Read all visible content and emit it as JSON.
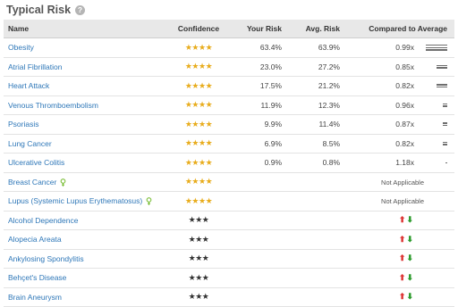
{
  "title": "Typical Risk",
  "help_icon": "?",
  "columns": [
    "Name",
    "Confidence",
    "Your Risk",
    "Avg. Risk",
    "Compared to Average"
  ],
  "rows_full": [
    {
      "name": "Obesity",
      "stars": "★★★★",
      "your": "63.4%",
      "avg": "63.9%",
      "ratio": "0.99x",
      "bar_lines": 3
    },
    {
      "name": "Atrial Fibrillation",
      "stars": "★★★★",
      "your": "23.0%",
      "avg": "27.2%",
      "ratio": "0.85x",
      "bar_lines": 2
    },
    {
      "name": "Heart Attack",
      "stars": "★★★★",
      "your": "17.5%",
      "avg": "21.2%",
      "ratio": "0.82x",
      "bar_lines": 2
    },
    {
      "name": "Venous Thromboembolism",
      "stars": "★★★★",
      "your": "11.9%",
      "avg": "12.3%",
      "ratio": "0.96x",
      "bar_lines": 2
    },
    {
      "name": "Psoriasis",
      "stars": "★★★★",
      "your": "9.9%",
      "avg": "11.4%",
      "ratio": "0.87x",
      "bar_lines": 2
    },
    {
      "name": "Lung Cancer",
      "stars": "★★★★",
      "your": "6.9%",
      "avg": "8.5%",
      "ratio": "0.82x",
      "bar_lines": 2
    },
    {
      "name": "Ulcerative Colitis",
      "stars": "★★★★",
      "your": "0.9%",
      "avg": "0.8%",
      "ratio": "1.18x",
      "bar_lines": 1
    }
  ],
  "rows_na": [
    {
      "name": "Breast Cancer",
      "stars": "★★★★",
      "note": "Not Applicable",
      "icon": "female-symbol-icon"
    },
    {
      "name": "Lupus (Systemic Lupus Erythematosus)",
      "stars": "★★★★",
      "note": "Not Applicable",
      "icon": "female-symbol-icon"
    }
  ],
  "rows_arrow": [
    {
      "name": "Alcohol Dependence",
      "stars": "★★★",
      "up": "⬆",
      "down": "⬇"
    },
    {
      "name": "Alopecia Areata",
      "stars": "★★★",
      "up": "⬆",
      "down": "⬇"
    },
    {
      "name": "Ankylosing Spondylitis",
      "stars": "★★★",
      "up": "⬆",
      "down": "⬇"
    },
    {
      "name": "Behçet's Disease",
      "stars": "★★★",
      "up": "⬆",
      "down": "⬇"
    },
    {
      "name": "Brain Aneurysm",
      "stars": "★★★",
      "up": "⬆",
      "down": "⬇"
    }
  ],
  "colors": {
    "link": "#2e77b8",
    "gold_star": "#e8ac1c",
    "up_arrow": "#dd3333",
    "down_arrow": "#2a9a2a",
    "female_icon": "#7cbf3a"
  }
}
